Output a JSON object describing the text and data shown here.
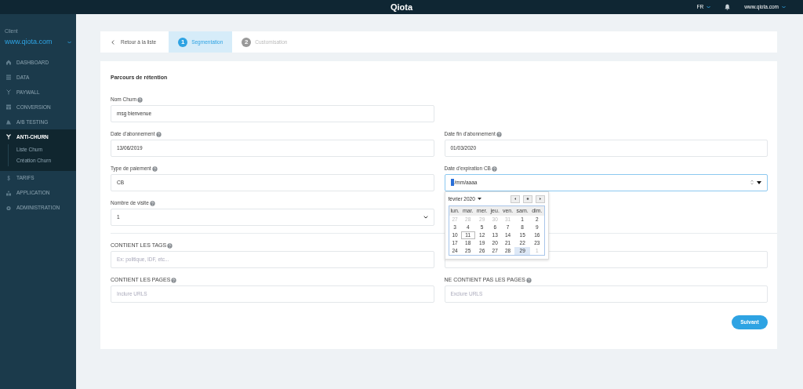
{
  "topbar": {
    "title": "Qiota",
    "language": "FR",
    "account": "www.qiota.com"
  },
  "sidebar": {
    "client_label": "Client",
    "client": "www.qiota.com",
    "items": [
      {
        "label": "DASHBOARD",
        "selected": false
      },
      {
        "label": "DATA",
        "selected": false
      },
      {
        "label": "PAYWALL",
        "selected": false
      },
      {
        "label": "CONVERSION",
        "selected": false
      },
      {
        "label": "A/B TESTING",
        "selected": false
      },
      {
        "label": "ANTI-CHURN",
        "selected": true,
        "children": [
          {
            "label": "Liste Churn"
          },
          {
            "label": "Création Churn"
          }
        ]
      },
      {
        "label": "TARIFS",
        "selected": false
      },
      {
        "label": "APPLICATION",
        "selected": false
      },
      {
        "label": "ADMINISTRATION",
        "selected": false
      }
    ]
  },
  "steps": {
    "back": "Retour à la liste",
    "items": [
      {
        "number": "1",
        "label": "Segmentation",
        "selected": true
      },
      {
        "number": "2",
        "label": "Customisation",
        "selected": false
      }
    ]
  },
  "form": {
    "title": "Parcours de rétention",
    "groups": [
      {
        "rows": [
          [
            {
              "kind": "text",
              "label": "Nom Churn",
              "value": "msg bienvenue"
            }
          ],
          [
            {
              "kind": "text",
              "label": "Date d'abonnement",
              "value": "13/06/2019"
            },
            {
              "kind": "text",
              "label": "Date fin d'abonnement",
              "value": "01/03/2020"
            }
          ],
          [
            {
              "kind": "text",
              "label": "Type de paiement",
              "value": "CB"
            },
            {
              "kind": "date",
              "label": "Date d'expiration CB",
              "value": "/mm/aaaa",
              "focused": true,
              "picker": {
                "month": "février 2020",
                "weekdays": [
                  "lun.",
                  "mar.",
                  "mer.",
                  "jeu.",
                  "ven.",
                  "sam.",
                  "dim."
                ],
                "weeks": [
                  [
                    {
                      "day": "27",
                      "outside": true,
                      "today": false,
                      "selected": false
                    },
                    {
                      "day": "28",
                      "outside": true,
                      "today": false,
                      "selected": false
                    },
                    {
                      "day": "29",
                      "outside": true,
                      "today": false,
                      "selected": false
                    },
                    {
                      "day": "30",
                      "outside": true,
                      "today": false,
                      "selected": false
                    },
                    {
                      "day": "31",
                      "outside": true,
                      "today": false,
                      "selected": false
                    },
                    {
                      "day": "1",
                      "outside": false,
                      "today": false,
                      "selected": false
                    },
                    {
                      "day": "2",
                      "outside": false,
                      "today": false,
                      "selected": false
                    }
                  ],
                  [
                    {
                      "day": "3",
                      "outside": false,
                      "today": false,
                      "selected": false
                    },
                    {
                      "day": "4",
                      "outside": false,
                      "today": false,
                      "selected": false
                    },
                    {
                      "day": "5",
                      "outside": false,
                      "today": false,
                      "selected": false
                    },
                    {
                      "day": "6",
                      "outside": false,
                      "today": false,
                      "selected": false
                    },
                    {
                      "day": "7",
                      "outside": false,
                      "today": false,
                      "selected": false
                    },
                    {
                      "day": "8",
                      "outside": false,
                      "today": false,
                      "selected": false
                    },
                    {
                      "day": "9",
                      "outside": false,
                      "today": false,
                      "selected": false
                    }
                  ],
                  [
                    {
                      "day": "10",
                      "outside": false,
                      "today": false,
                      "selected": false
                    },
                    {
                      "day": "11",
                      "outside": false,
                      "today": true,
                      "selected": false
                    },
                    {
                      "day": "12",
                      "outside": false,
                      "today": false,
                      "selected": false
                    },
                    {
                      "day": "13",
                      "outside": false,
                      "today": false,
                      "selected": false
                    },
                    {
                      "day": "14",
                      "outside": false,
                      "today": false,
                      "selected": false
                    },
                    {
                      "day": "15",
                      "outside": false,
                      "today": false,
                      "selected": false
                    },
                    {
                      "day": "16",
                      "outside": false,
                      "today": false,
                      "selected": false
                    }
                  ],
                  [
                    {
                      "day": "17",
                      "outside": false,
                      "today": false,
                      "selected": false
                    },
                    {
                      "day": "18",
                      "outside": false,
                      "today": false,
                      "selected": false
                    },
                    {
                      "day": "19",
                      "outside": false,
                      "today": false,
                      "selected": false
                    },
                    {
                      "day": "20",
                      "outside": false,
                      "today": false,
                      "selected": false
                    },
                    {
                      "day": "21",
                      "outside": false,
                      "today": false,
                      "selected": false
                    },
                    {
                      "day": "22",
                      "outside": false,
                      "today": false,
                      "selected": false
                    },
                    {
                      "day": "23",
                      "outside": false,
                      "today": false,
                      "selected": false
                    }
                  ],
                  [
                    {
                      "day": "24",
                      "outside": false,
                      "today": false,
                      "selected": false
                    },
                    {
                      "day": "25",
                      "outside": false,
                      "today": false,
                      "selected": false
                    },
                    {
                      "day": "26",
                      "outside": false,
                      "today": false,
                      "selected": false
                    },
                    {
                      "day": "27",
                      "outside": false,
                      "today": false,
                      "selected": false
                    },
                    {
                      "day": "28",
                      "outside": false,
                      "today": false,
                      "selected": false
                    },
                    {
                      "day": "29",
                      "outside": false,
                      "today": false,
                      "selected": true
                    },
                    {
                      "day": "1",
                      "outside": true,
                      "today": false,
                      "selected": false
                    }
                  ]
                ]
              }
            }
          ],
          [
            {
              "kind": "select",
              "label": "Nombre de visite",
              "value": "1"
            }
          ]
        ]
      },
      {
        "rows": [
          [
            {
              "kind": "text",
              "label": "CONTIENT LES TAGS",
              "placeholder": "Ex: politique, IDF, etc..."
            },
            {
              "kind": "text"
            }
          ],
          [
            {
              "kind": "text",
              "label": "CONTIENT LES PAGES",
              "placeholder": "Inclure URLS"
            },
            {
              "kind": "text",
              "label": "NE CONTIENT PAS LES PAGES",
              "placeholder": "Exclure URLS"
            }
          ]
        ]
      }
    ],
    "submit": "Suivant"
  }
}
